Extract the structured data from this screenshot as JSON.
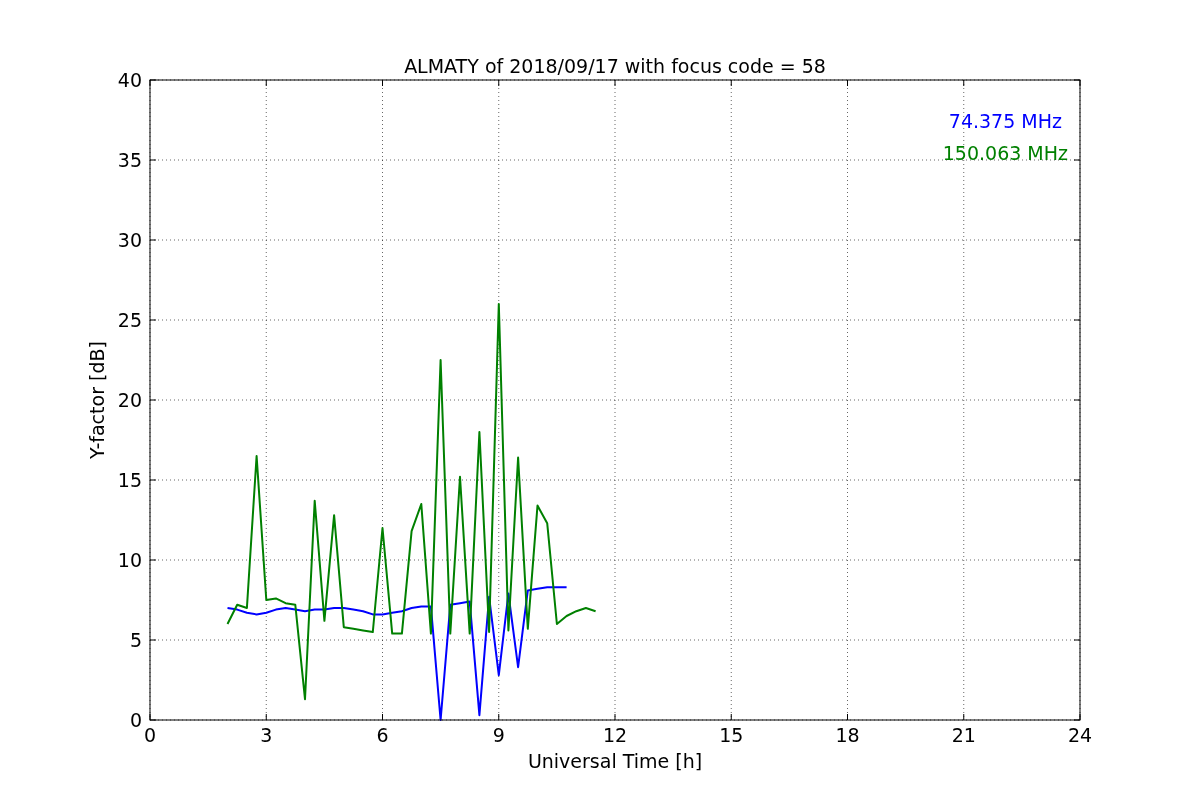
{
  "chart_data": {
    "type": "line",
    "title": "ALMATY of 2018/09/17 with focus code = 58",
    "xlabel": "Universal Time [h]",
    "ylabel": "Y-factor [dB]",
    "x": [
      2.0,
      2.25,
      2.5,
      2.75,
      3.0,
      3.25,
      3.5,
      3.75,
      4.0,
      4.25,
      4.5,
      4.75,
      5.0,
      5.25,
      5.5,
      5.75,
      6.0,
      6.25,
      6.5,
      6.75,
      7.0,
      7.25,
      7.5,
      7.75,
      8.0,
      8.25,
      8.5,
      8.75,
      9.0,
      9.25,
      9.5,
      9.75,
      10.0,
      10.25,
      10.5,
      10.75,
      11.0,
      11.25,
      11.5
    ],
    "series": [
      {
        "name": "74.375 MHz",
        "color": "#0000ff",
        "values": [
          7.0,
          6.9,
          6.7,
          6.6,
          6.7,
          6.9,
          7.0,
          6.9,
          6.8,
          6.9,
          6.9,
          7.0,
          7.0,
          6.9,
          6.8,
          6.6,
          6.6,
          6.7,
          6.8,
          7.0,
          7.1,
          7.1,
          0.0,
          7.2,
          7.3,
          7.4,
          0.3,
          7.7,
          2.8,
          7.9,
          3.3,
          8.1,
          8.2,
          8.3,
          8.3,
          8.3,
          null,
          null,
          null
        ]
      },
      {
        "name": "150.063 MHz",
        "color": "#008000",
        "values": [
          6.0,
          7.2,
          7.0,
          16.5,
          7.5,
          7.6,
          7.3,
          7.2,
          1.3,
          13.7,
          6.2,
          12.8,
          5.8,
          5.7,
          5.6,
          5.5,
          12.0,
          5.4,
          5.4,
          11.8,
          13.5,
          5.4,
          22.5,
          5.4,
          15.2,
          5.4,
          18.0,
          5.5,
          26.0,
          5.6,
          16.4,
          5.7,
          13.4,
          12.3,
          6.0,
          6.5,
          6.8,
          7.0,
          6.8
        ]
      }
    ],
    "grid": true,
    "xlim": [
      0,
      24
    ],
    "ylim": [
      0,
      40
    ],
    "xticks": [
      0,
      3,
      6,
      9,
      12,
      15,
      18,
      21,
      24
    ],
    "yticks": [
      0,
      5,
      10,
      15,
      20,
      25,
      30,
      35,
      40
    ]
  }
}
